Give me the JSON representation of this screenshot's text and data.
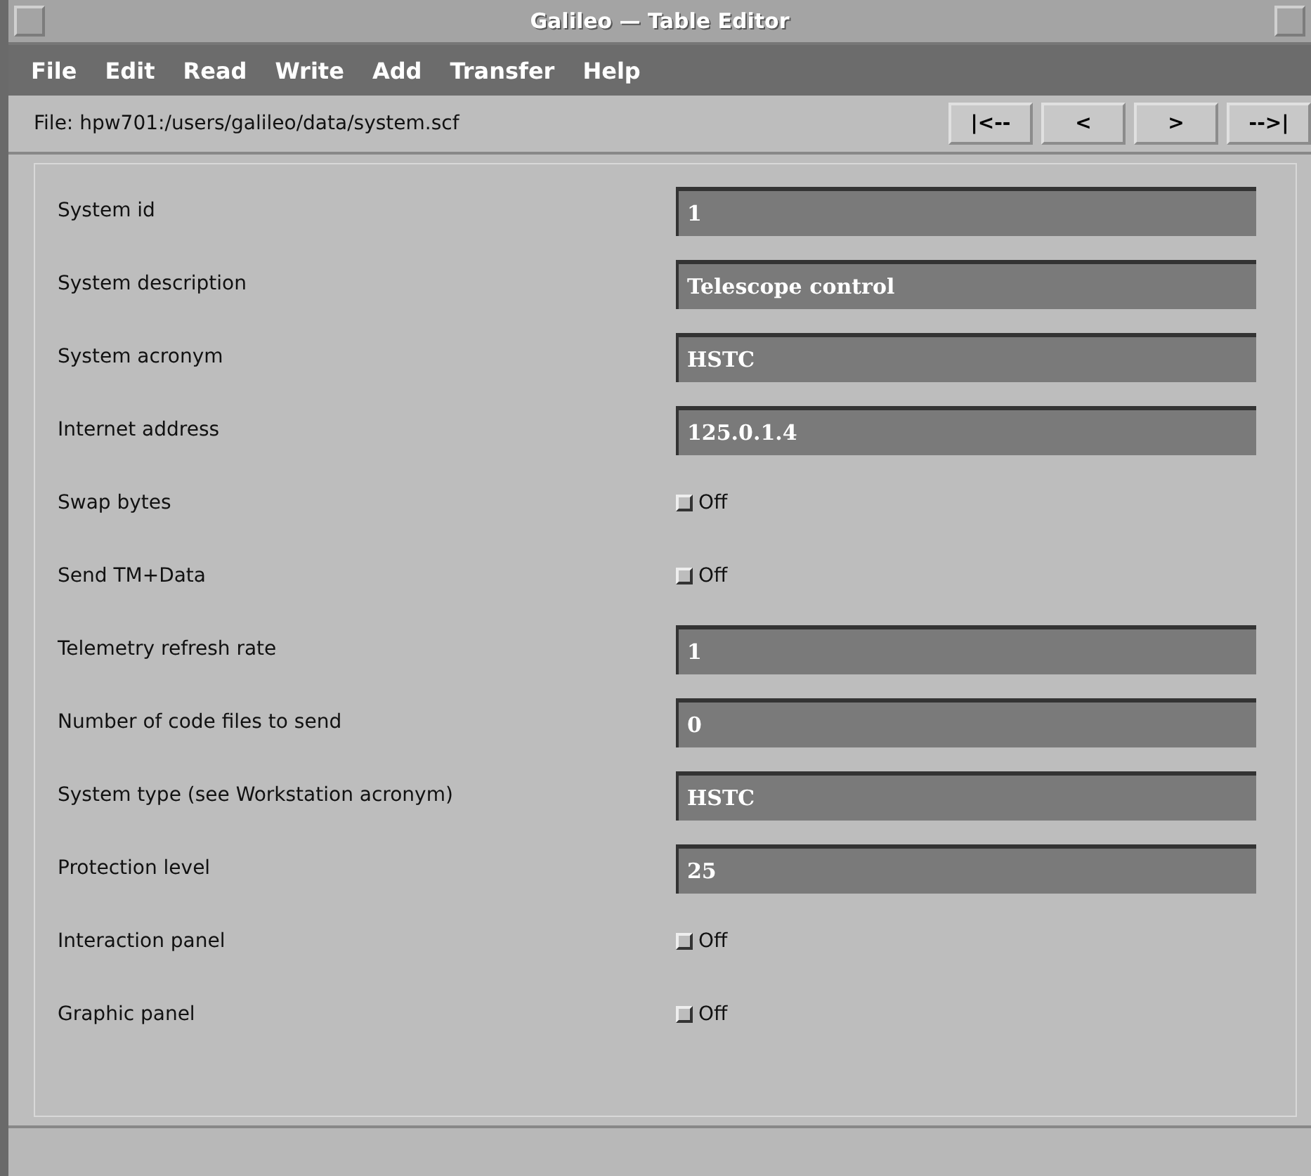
{
  "window": {
    "title": "Galileo — Table Editor"
  },
  "menu": [
    "File",
    "Edit",
    "Read",
    "Write",
    "Add",
    "Transfer",
    "Help"
  ],
  "file_bar": {
    "label": "File: hpw701:/users/galileo/data/system.scf",
    "buttons": [
      "|<--",
      "<",
      ">",
      "-->|"
    ]
  },
  "fields": [
    {
      "kind": "text",
      "label": "System id",
      "value": "1"
    },
    {
      "kind": "text",
      "label": "System description",
      "value": "Telescope control"
    },
    {
      "kind": "text",
      "label": "System acronym",
      "value": "HSTC"
    },
    {
      "kind": "text",
      "label": "Internet address",
      "value": "125.0.1.4"
    },
    {
      "kind": "toggle",
      "label": "Swap bytes",
      "checked": false,
      "value": "Off"
    },
    {
      "kind": "toggle",
      "label": "Send TM+Data",
      "checked": false,
      "value": "Off"
    },
    {
      "kind": "text",
      "label": "Telemetry refresh rate",
      "value": "1"
    },
    {
      "kind": "text",
      "label": "Number of code files to send",
      "value": "0"
    },
    {
      "kind": "text",
      "label": "System type (see Workstation acronym)",
      "value": "HSTC"
    },
    {
      "kind": "text",
      "label": "Protection level",
      "value": "25"
    },
    {
      "kind": "toggle",
      "label": "Interaction panel",
      "checked": false,
      "value": "Off"
    },
    {
      "kind": "toggle",
      "label": "Graphic panel",
      "checked": false,
      "value": "Off"
    }
  ]
}
